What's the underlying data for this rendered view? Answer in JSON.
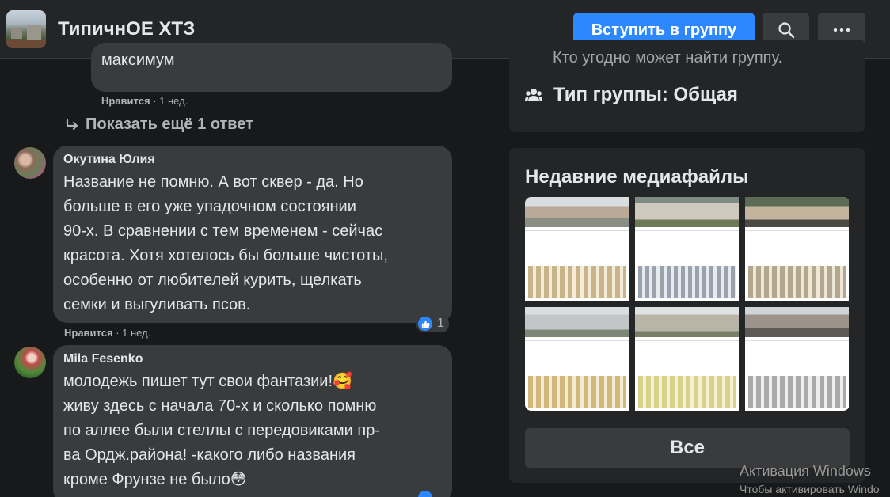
{
  "header": {
    "group_name": "ТипичнОЕ ХТЗ",
    "join_button": "Вступить в группу",
    "search_icon": "search-icon",
    "more_icon": "more-icon"
  },
  "comments": {
    "prev_reply": {
      "text": "максимум",
      "like_label": "Нравится",
      "time": "1 нед."
    },
    "show_more": "Показать ещё 1 ответ",
    "items": [
      {
        "author": "Окутина Юлия",
        "lines": [
          "Название не помню. А вот сквер - да. Но",
          "больше в его уже упадочном состоянии",
          "90-х. В сравнении с тем временем - сейчас",
          "красота. Хотя хотелось бы больше чистоты,",
          "особенно от любителей курить, щелкать",
          "семки и выгуливать псов."
        ],
        "like_label": "Нравится",
        "time": "1 нед.",
        "reactions": "1"
      },
      {
        "author": "Mila Fesenko",
        "lines": [
          "молодежь пишет тут свои фантазии!🥰",
          "живу здесь с начала 70-х и сколько помню",
          "по аллее были стеллы с передовиками пр-",
          "ва Ордж.района! -какого либо названия",
          "кроме Фрунзе не было😳"
        ]
      }
    ]
  },
  "about": {
    "visibility_text": "Кто угодно может найти группу.",
    "group_type": "Тип группы: Общая"
  },
  "media": {
    "title": "Недавние медиафайлы",
    "all_button": "Все"
  },
  "watermark": {
    "line1": "Активация Windows",
    "line2": "Чтобы активировать Windo"
  },
  "colors": {
    "accent": "#2d88ff",
    "background": "#18191a",
    "surface": "#242526",
    "bubble": "#3a3b3c"
  }
}
